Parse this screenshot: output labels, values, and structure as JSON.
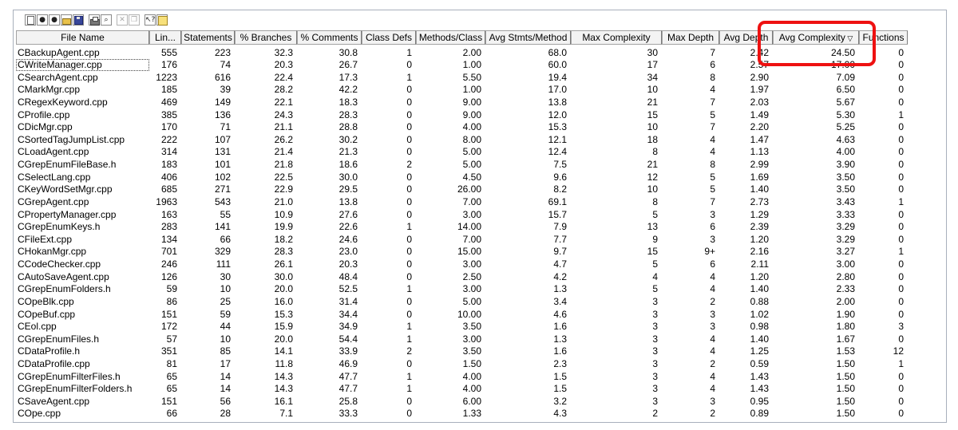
{
  "toolbar": {
    "buttons": [
      {
        "icon": "new-icon",
        "disabled": false
      },
      {
        "icon": "stop-icon",
        "disabled": false
      },
      {
        "icon": "record-icon",
        "disabled": false
      },
      {
        "icon": "open-folder-icon",
        "disabled": false
      },
      {
        "icon": "save-icon",
        "disabled": false
      },
      {
        "icon": "print-icon",
        "disabled": false
      },
      {
        "icon": "print-preview-icon",
        "disabled": false
      },
      {
        "icon": "cut-icon",
        "disabled": true
      },
      {
        "icon": "copy-icon",
        "disabled": true
      },
      {
        "icon": "context-help-icon",
        "disabled": false
      },
      {
        "icon": "help-book-icon",
        "disabled": false
      }
    ]
  },
  "table": {
    "sorted_column": "Avg Complexity",
    "sort_direction": "descending",
    "columns": [
      "File Name",
      "Lin...",
      "Statements",
      "% Branches",
      "% Comments",
      "Class Defs",
      "Methods/Class",
      "Avg Stmts/Method",
      "Max Complexity",
      "Max Depth",
      "Avg Depth",
      "Avg Complexity",
      "Functions"
    ],
    "rows": [
      [
        "CBackupAgent.cpp",
        "555",
        "223",
        "32.3",
        "30.8",
        "1",
        "2.00",
        "68.0",
        "30",
        "7",
        "2.42",
        "24.50",
        "0"
      ],
      [
        "CWriteManager.cpp",
        "176",
        "74",
        "20.3",
        "26.7",
        "0",
        "1.00",
        "60.0",
        "17",
        "6",
        "2.57",
        "17.00",
        "0"
      ],
      [
        "CSearchAgent.cpp",
        "1223",
        "616",
        "22.4",
        "17.3",
        "1",
        "5.50",
        "19.4",
        "34",
        "8",
        "2.90",
        "7.09",
        "0"
      ],
      [
        "CMarkMgr.cpp",
        "185",
        "39",
        "28.2",
        "42.2",
        "0",
        "1.00",
        "17.0",
        "10",
        "4",
        "1.97",
        "6.50",
        "0"
      ],
      [
        "CRegexKeyword.cpp",
        "469",
        "149",
        "22.1",
        "18.3",
        "0",
        "9.00",
        "13.8",
        "21",
        "7",
        "2.03",
        "5.67",
        "0"
      ],
      [
        "CProfile.cpp",
        "385",
        "136",
        "24.3",
        "28.3",
        "0",
        "9.00",
        "12.0",
        "15",
        "5",
        "1.49",
        "5.30",
        "1"
      ],
      [
        "CDicMgr.cpp",
        "170",
        "71",
        "21.1",
        "28.8",
        "0",
        "4.00",
        "15.3",
        "10",
        "7",
        "2.20",
        "5.25",
        "0"
      ],
      [
        "CSortedTagJumpList.cpp",
        "222",
        "107",
        "26.2",
        "30.2",
        "0",
        "8.00",
        "12.1",
        "18",
        "4",
        "1.47",
        "4.63",
        "0"
      ],
      [
        "CLoadAgent.cpp",
        "314",
        "131",
        "21.4",
        "21.3",
        "0",
        "5.00",
        "12.4",
        "8",
        "4",
        "1.13",
        "4.00",
        "0"
      ],
      [
        "CGrepEnumFileBase.h",
        "183",
        "101",
        "21.8",
        "18.6",
        "2",
        "5.00",
        "7.5",
        "21",
        "8",
        "2.99",
        "3.90",
        "0"
      ],
      [
        "CSelectLang.cpp",
        "406",
        "102",
        "22.5",
        "30.0",
        "0",
        "4.50",
        "9.6",
        "12",
        "5",
        "1.69",
        "3.50",
        "0"
      ],
      [
        "CKeyWordSetMgr.cpp",
        "685",
        "271",
        "22.9",
        "29.5",
        "0",
        "26.00",
        "8.2",
        "10",
        "5",
        "1.40",
        "3.50",
        "0"
      ],
      [
        "CGrepAgent.cpp",
        "1963",
        "543",
        "21.0",
        "13.8",
        "0",
        "7.00",
        "69.1",
        "8",
        "7",
        "2.73",
        "3.43",
        "1"
      ],
      [
        "CPropertyManager.cpp",
        "163",
        "55",
        "10.9",
        "27.6",
        "0",
        "3.00",
        "15.7",
        "5",
        "3",
        "1.29",
        "3.33",
        "0"
      ],
      [
        "CGrepEnumKeys.h",
        "283",
        "141",
        "19.9",
        "22.6",
        "1",
        "14.00",
        "7.9",
        "13",
        "6",
        "2.39",
        "3.29",
        "0"
      ],
      [
        "CFileExt.cpp",
        "134",
        "66",
        "18.2",
        "24.6",
        "0",
        "7.00",
        "7.7",
        "9",
        "3",
        "1.20",
        "3.29",
        "0"
      ],
      [
        "CHokanMgr.cpp",
        "701",
        "329",
        "28.3",
        "23.0",
        "0",
        "15.00",
        "9.7",
        "15",
        "9+",
        "2.16",
        "3.27",
        "1"
      ],
      [
        "CCodeChecker.cpp",
        "246",
        "111",
        "26.1",
        "20.3",
        "0",
        "3.00",
        "4.7",
        "5",
        "6",
        "2.11",
        "3.00",
        "0"
      ],
      [
        "CAutoSaveAgent.cpp",
        "126",
        "30",
        "30.0",
        "48.4",
        "0",
        "2.50",
        "4.2",
        "4",
        "4",
        "1.20",
        "2.80",
        "0"
      ],
      [
        "CGrepEnumFolders.h",
        "59",
        "10",
        "20.0",
        "52.5",
        "1",
        "3.00",
        "1.3",
        "5",
        "4",
        "1.40",
        "2.33",
        "0"
      ],
      [
        "COpeBlk.cpp",
        "86",
        "25",
        "16.0",
        "31.4",
        "0",
        "5.00",
        "3.4",
        "3",
        "2",
        "0.88",
        "2.00",
        "0"
      ],
      [
        "COpeBuf.cpp",
        "151",
        "59",
        "15.3",
        "34.4",
        "0",
        "10.00",
        "4.6",
        "3",
        "3",
        "1.02",
        "1.90",
        "0"
      ],
      [
        "CEol.cpp",
        "172",
        "44",
        "15.9",
        "34.9",
        "1",
        "3.50",
        "1.6",
        "3",
        "3",
        "0.98",
        "1.80",
        "3"
      ],
      [
        "CGrepEnumFiles.h",
        "57",
        "10",
        "20.0",
        "54.4",
        "1",
        "3.00",
        "1.3",
        "3",
        "4",
        "1.40",
        "1.67",
        "0"
      ],
      [
        "CDataProfile.h",
        "351",
        "85",
        "14.1",
        "33.9",
        "2",
        "3.50",
        "1.6",
        "3",
        "4",
        "1.25",
        "1.53",
        "12"
      ],
      [
        "CDataProfile.cpp",
        "81",
        "17",
        "11.8",
        "46.9",
        "0",
        "1.50",
        "2.3",
        "3",
        "2",
        "0.59",
        "1.50",
        "1"
      ],
      [
        "CGrepEnumFilterFiles.h",
        "65",
        "14",
        "14.3",
        "47.7",
        "1",
        "4.00",
        "1.5",
        "3",
        "4",
        "1.43",
        "1.50",
        "0"
      ],
      [
        "CGrepEnumFilterFolders.h",
        "65",
        "14",
        "14.3",
        "47.7",
        "1",
        "4.00",
        "1.5",
        "3",
        "4",
        "1.43",
        "1.50",
        "0"
      ],
      [
        "CSaveAgent.cpp",
        "151",
        "56",
        "16.1",
        "25.8",
        "0",
        "6.00",
        "3.2",
        "3",
        "3",
        "0.95",
        "1.50",
        "0"
      ],
      [
        "COpe.cpp",
        "66",
        "28",
        "7.1",
        "33.3",
        "0",
        "1.33",
        "4.3",
        "2",
        "2",
        "0.89",
        "1.50",
        "0"
      ]
    ]
  },
  "colors": {
    "highlight": "#ee1111",
    "header_bg": "#f3f3f3",
    "border": "#a2a2a2"
  }
}
